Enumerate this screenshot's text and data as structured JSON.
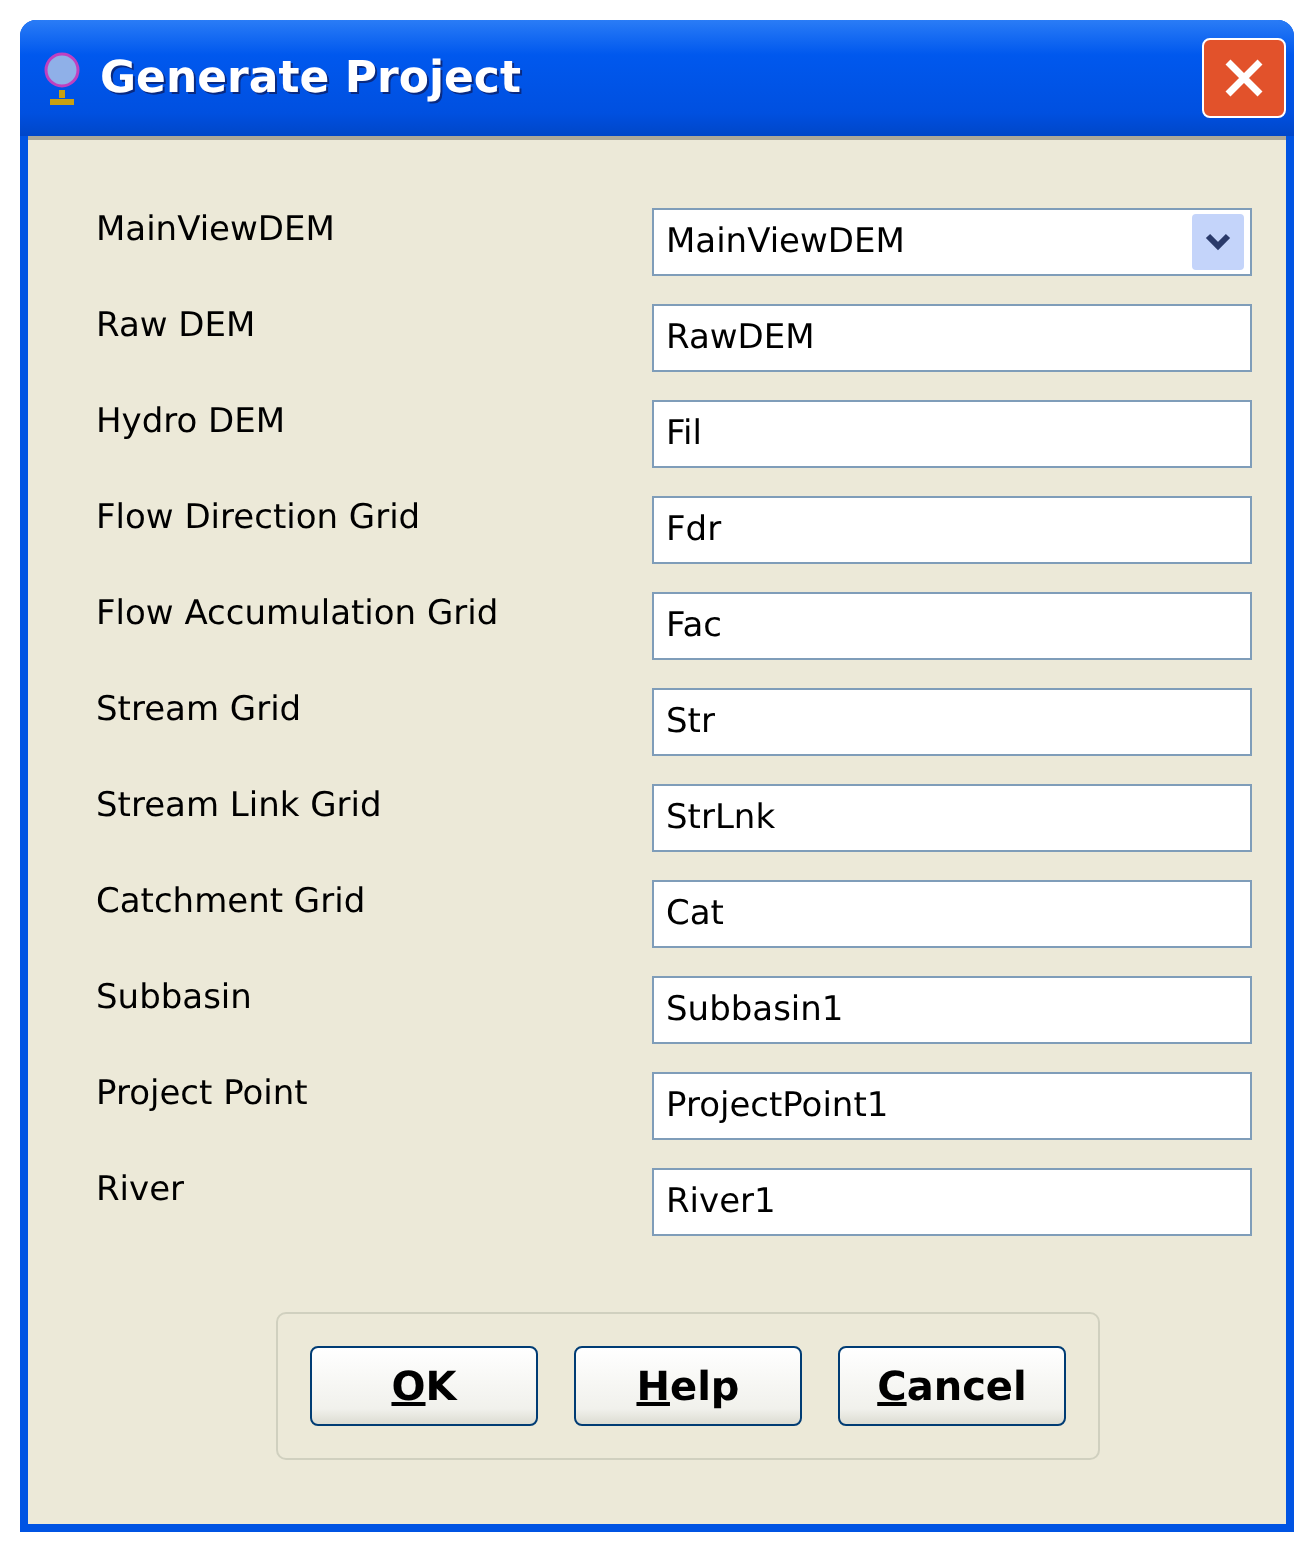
{
  "window": {
    "title": "Generate Project"
  },
  "fields": [
    {
      "label": "MainViewDEM",
      "kind": "dropdown",
      "value": "MainViewDEM"
    },
    {
      "label": "Raw DEM",
      "kind": "text",
      "value": "RawDEM"
    },
    {
      "label": "Hydro DEM",
      "kind": "text",
      "value": "Fil"
    },
    {
      "label": "Flow Direction Grid",
      "kind": "text",
      "value": "Fdr"
    },
    {
      "label": "Flow Accumulation Grid",
      "kind": "text",
      "value": "Fac"
    },
    {
      "label": "Stream Grid",
      "kind": "text",
      "value": "Str"
    },
    {
      "label": "Stream Link Grid",
      "kind": "text",
      "value": "StrLnk"
    },
    {
      "label": "Catchment Grid",
      "kind": "text",
      "value": "Cat"
    },
    {
      "label": "Subbasin",
      "kind": "text",
      "value": "Subbasin1"
    },
    {
      "label": "Project Point",
      "kind": "text",
      "value": "ProjectPoint1"
    },
    {
      "label": "River",
      "kind": "text",
      "value": "River1"
    }
  ],
  "buttons": [
    {
      "label": "OK"
    },
    {
      "label": "Help"
    },
    {
      "label": "Cancel"
    }
  ]
}
